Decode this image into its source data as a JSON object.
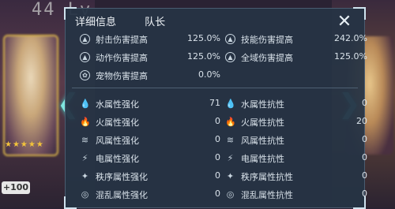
{
  "background": {
    "level_text": "44 Lv",
    "stars": "★★★★★",
    "plus_badge": "+100"
  },
  "header": {
    "tab_details": "详细信息",
    "tab_leader": "队长"
  },
  "stats_top": [
    {
      "icon": "arrow-up-icon",
      "label": "射击伤害提高",
      "value": "125.0%"
    },
    {
      "icon": "arrow-up-icon",
      "label": "技能伤害提高",
      "value": "242.0%"
    },
    {
      "icon": "arrow-up-icon",
      "label": "动作伤害提高",
      "value": "125.0%"
    },
    {
      "icon": "arrow-up-icon",
      "label": "全域伤害提高",
      "value": "125.0%"
    },
    {
      "icon": "pet-icon",
      "label": "宠物伤害提高",
      "value": "0.0%"
    }
  ],
  "stats_elements": [
    {
      "icon": "water-icon",
      "label": "水属性强化",
      "value": "71"
    },
    {
      "icon": "water-resist-icon",
      "label": "水属性抗性",
      "value": "0"
    },
    {
      "icon": "fire-icon",
      "label": "火属性强化",
      "value": "0"
    },
    {
      "icon": "fire-resist-icon",
      "label": "火属性抗性",
      "value": "20"
    },
    {
      "icon": "wind-icon",
      "label": "风属性强化",
      "value": "0"
    },
    {
      "icon": "wind-resist-icon",
      "label": "风属性抗性",
      "value": "0"
    },
    {
      "icon": "lightning-icon",
      "label": "电属性强化",
      "value": "0"
    },
    {
      "icon": "lightning-resist-icon",
      "label": "电属性抗性",
      "value": "0"
    },
    {
      "icon": "order-icon",
      "label": "秩序属性强化",
      "value": "0"
    },
    {
      "icon": "order-resist-icon",
      "label": "秩序属性抗性",
      "value": "0"
    },
    {
      "icon": "chaos-icon",
      "label": "混乱属性强化",
      "value": "0"
    },
    {
      "icon": "chaos-resist-icon",
      "label": "混乱属性抗性",
      "value": "0"
    }
  ]
}
